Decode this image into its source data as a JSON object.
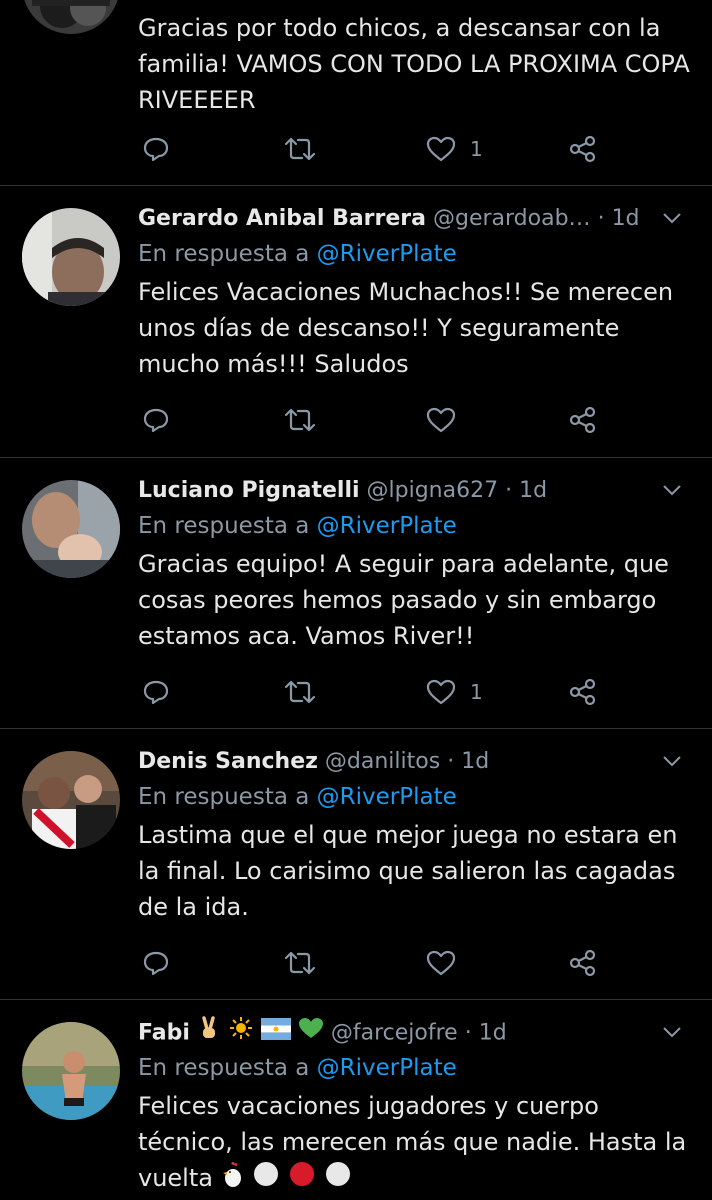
{
  "reply_prefix": "En respuesta a",
  "tweets": [
    {
      "name": "",
      "handle": "",
      "time": "",
      "reply_to": "",
      "text": "Gracias por todo chicos, a descansar con la familia! VAMOS CON TODO LA PROXIMA COPA RIVEEEER",
      "like_count": "1"
    },
    {
      "name": "Gerardo Anibal Barrera",
      "handle": "@gerardoab…",
      "time": "1d",
      "reply_to": "@RiverPlate",
      "text": "Felices Vacaciones Muchachos!! Se merecen unos días de descanso!! Y seguramente mucho más!!! Saludos",
      "like_count": ""
    },
    {
      "name": "Luciano Pignatelli",
      "handle": "@lpigna627",
      "time": "1d",
      "reply_to": "@RiverPlate",
      "text": "Gracias equipo! A seguir para adelante, que cosas peores hemos pasado y sin embargo estamos aca. Vamos River!!",
      "like_count": "1"
    },
    {
      "name": "Denis Sanchez",
      "handle": "@danilitos",
      "time": "1d",
      "reply_to": "@RiverPlate",
      "text": "Lastima que el que mejor juega no estara en la final. Lo carisimo que salieron las cagadas de la ida.",
      "like_count": ""
    },
    {
      "name": "Fabi",
      "name_emojis": [
        "victory-hand",
        "sun",
        "argentina-flag",
        "green-heart"
      ],
      "handle": "@farcejofre",
      "time": "1d",
      "reply_to": "@RiverPlate",
      "text": "Felices vacaciones jugadores y cuerpo técnico, las merecen más que nadie. Hasta la vuelta",
      "text_emojis": [
        "rooster",
        "white-circle",
        "red-circle",
        "white-circle"
      ],
      "like_count": ""
    }
  ],
  "colors": {
    "background": "#000000",
    "text": "#e6e6e6",
    "muted": "#8b98a5",
    "link": "#1d9bf0",
    "divider": "#2f3336"
  }
}
